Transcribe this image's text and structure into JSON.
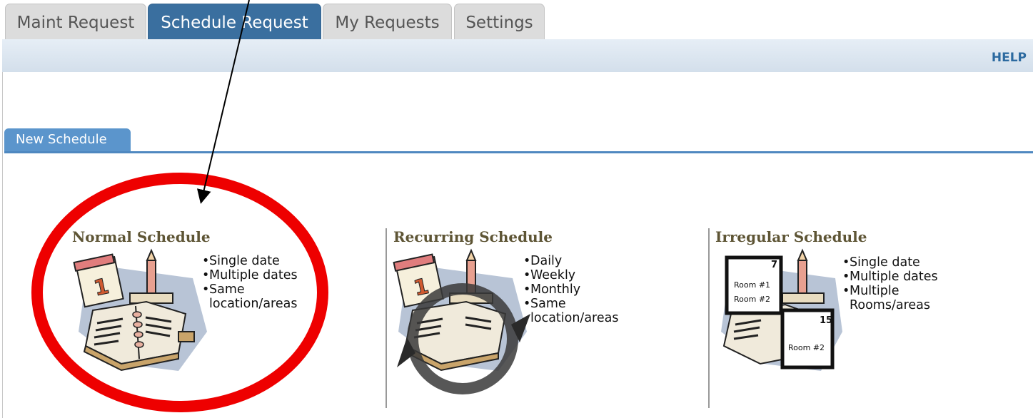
{
  "tabs": [
    {
      "label": "Maint Request",
      "active": false
    },
    {
      "label": "Schedule Request",
      "active": true
    },
    {
      "label": "My Requests",
      "active": false
    },
    {
      "label": "Settings",
      "active": false
    }
  ],
  "help_label": "HELP",
  "section_tab": "New Schedule",
  "options": [
    {
      "title": "Normal Schedule",
      "items": [
        "Single date",
        "Multiple dates",
        "Same location/areas"
      ]
    },
    {
      "title": "Recurring Schedule",
      "items": [
        "Daily",
        "Weekly",
        "Monthly",
        "Same location/areas"
      ]
    },
    {
      "title": "Irregular Schedule",
      "items": [
        "Single date",
        "Multiple dates",
        "Multiple Rooms/areas"
      ],
      "room_labels": [
        "Room #1",
        "Room #2",
        "Room #2"
      ],
      "card_numbers": [
        "7",
        "15"
      ]
    }
  ],
  "calendar_day": "1",
  "colors": {
    "active_tab": "#3a6f9f",
    "section_tab": "#5b95cc",
    "annotation": "#ee0000",
    "title": "#5e5535"
  }
}
